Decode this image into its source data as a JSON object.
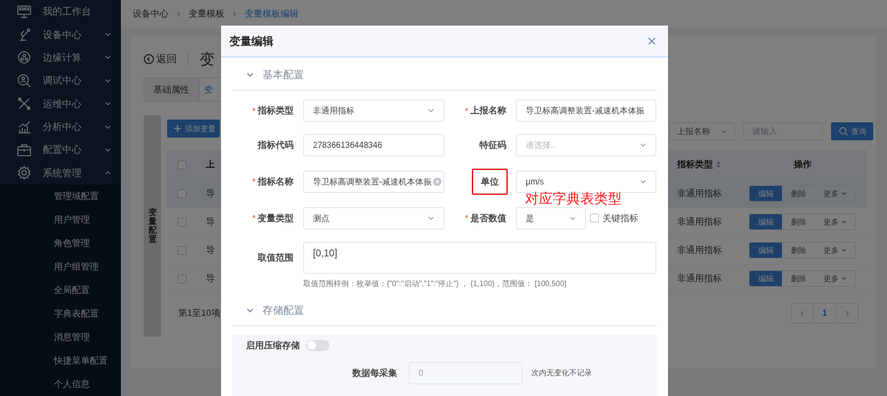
{
  "sidebar": {
    "items": [
      {
        "label": "我的工作台"
      },
      {
        "label": "设备中心",
        "expanded": false
      },
      {
        "label": "边缘计算",
        "expanded": false
      },
      {
        "label": "调试中心",
        "expanded": false
      },
      {
        "label": "运维中心",
        "expanded": false
      },
      {
        "label": "分析中心",
        "expanded": false
      },
      {
        "label": "配置中心",
        "expanded": false
      },
      {
        "label": "系统管理",
        "expanded": true,
        "children": [
          {
            "label": "管理域配置"
          },
          {
            "label": "用户管理"
          },
          {
            "label": "角色管理"
          },
          {
            "label": "用户组管理"
          },
          {
            "label": "全局配置"
          },
          {
            "label": "字典表配置"
          },
          {
            "label": "消息管理"
          },
          {
            "label": "快捷菜单配置"
          },
          {
            "label": "个人信息"
          }
        ]
      }
    ]
  },
  "breadcrumb": [
    {
      "label": "设备中心",
      "selected": false
    },
    {
      "label": "变量模板",
      "selected": false
    },
    {
      "label": "变量模板编辑",
      "selected": true
    }
  ],
  "page": {
    "back": "返回",
    "title": "变"
  },
  "tabs": [
    {
      "label": "基础属性",
      "selected": false
    },
    {
      "label": "变",
      "selected": true
    }
  ],
  "side_tab": "变量配置",
  "toolbar": {
    "add_button": "添加变量",
    "filter_select": "上报名称",
    "search_placeholder": "请输入",
    "search_button": "查询"
  },
  "table": {
    "all_checked": false,
    "columns": [
      "上",
      "指标类型",
      "操作"
    ],
    "rows": [
      {
        "selected": true,
        "checked": false,
        "cells": [
          "导",
          "非通用指标"
        ],
        "actions": [
          "编辑",
          "删除",
          "更多"
        ]
      },
      {
        "selected": false,
        "checked": false,
        "cells": [
          "导",
          "非通用指标"
        ],
        "actions": [
          "编辑",
          "删除",
          "更多"
        ]
      },
      {
        "selected": false,
        "checked": false,
        "cells": [
          "导",
          "非通用指标"
        ],
        "actions": [
          "编辑",
          "删除",
          "更多"
        ]
      },
      {
        "selected": false,
        "checked": false,
        "cells": [
          "导",
          "非通用指标"
        ],
        "actions": [
          "编辑",
          "删除",
          "更多"
        ]
      }
    ]
  },
  "pagination": {
    "summary": "第1至10项",
    "pages": [
      {
        "label": "1",
        "selected": true
      }
    ]
  },
  "dialog": {
    "title": "变量编辑",
    "sections": [
      {
        "title": "基本配置",
        "expanded": true,
        "fields": [
          {
            "kind": "select",
            "required_mark": "*",
            "label": "指标类型",
            "value": "非通用指标"
          },
          {
            "kind": "input",
            "required_mark": "*",
            "label": "上报名称",
            "value": "导卫标高调整装置-减速机本体振"
          },
          {
            "kind": "input",
            "label": "指标代码",
            "value": "278366136448346"
          },
          {
            "kind": "select",
            "label": "特征码",
            "placeholder": "请选择.."
          },
          {
            "kind": "input",
            "required_mark": "*",
            "label": "指标名称",
            "value": "导卫标高调整装置-减速机本体振",
            "clearable": true
          },
          {
            "kind": "select",
            "label": "单位",
            "value": "μm/s",
            "highlighted": true
          },
          {
            "kind": "select",
            "required_mark": "*",
            "label": "变量类型",
            "value": "测点"
          },
          {
            "kind": "select",
            "required_mark": "*",
            "label": "是否数值",
            "value": "是",
            "checkbox": {
              "label": "关键指标",
              "checked": false
            }
          },
          {
            "kind": "textarea",
            "label": "取值范围",
            "value": "[0,10]",
            "hint": "取值范围样例：枚举值：{\"0\":\"启动\",\"1\":\"停止\"} ， {1,100}，范围值： [100,500]"
          }
        ]
      },
      {
        "title": "存储配置",
        "expanded": true,
        "toggle": {
          "label": "启用压缩存储",
          "on": false
        },
        "fields": [
          {
            "kind": "input",
            "label": "数据每采集",
            "value": "0",
            "disabled": true,
            "suffix": "次内无变化不记录"
          }
        ]
      }
    ]
  },
  "annotation": {
    "text": "对应字典表类型"
  }
}
